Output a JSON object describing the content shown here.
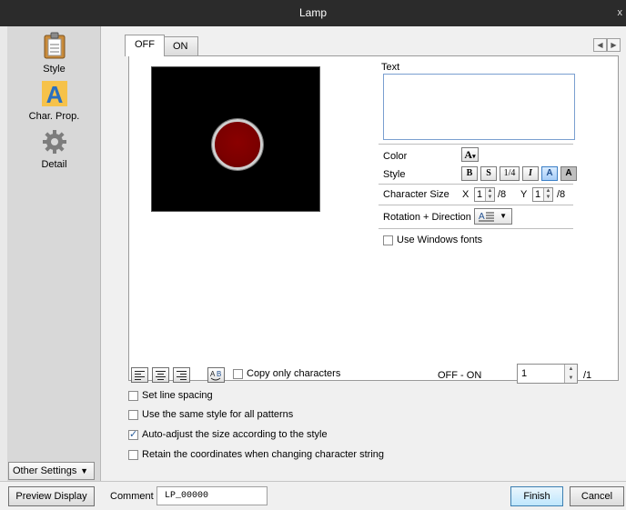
{
  "window": {
    "title": "Lamp",
    "close_glyph": "x"
  },
  "sidebar": {
    "items": [
      {
        "label": "Style",
        "icon": "clipboard-icon"
      },
      {
        "label": "Char. Prop.",
        "icon": "character-a-icon"
      },
      {
        "label": "Detail",
        "icon": "gear-icon"
      }
    ],
    "other_settings": "Other Settings"
  },
  "tabs": [
    {
      "label": "OFF"
    },
    {
      "label": "ON"
    }
  ],
  "lamp": {
    "color": "#7b0000"
  },
  "props": {
    "text_label": "Text",
    "text_value": "",
    "color_label": "Color",
    "color_button": "A",
    "style_label": "Style",
    "style_buttons": [
      "B",
      "S",
      "1/4",
      "I",
      "A",
      "A"
    ],
    "char_size_label": "Character Size",
    "x_label": "X",
    "x_value": "1",
    "x_suffix": "/8",
    "y_label": "Y",
    "y_value": "1",
    "y_suffix": "/8",
    "rotation_label": "Rotation + Direction",
    "use_windows_fonts": "Use Windows fonts"
  },
  "bottom_options": {
    "copy_only_characters": "Copy only characters",
    "off_on_label": "OFF - ON",
    "off_on_value": "1",
    "off_on_suffix": "/1",
    "set_line_spacing": "Set line spacing",
    "same_style": "Use the same style for all patterns",
    "auto_adjust": "Auto-adjust the size according to the style",
    "retain_coords": "Retain the coordinates when changing character string",
    "auto_adjust_checked": true
  },
  "footer": {
    "preview_display": "Preview Display",
    "comment_label": "Comment",
    "comment_value": "LP_00000",
    "finish": "Finish",
    "cancel": "Cancel"
  }
}
